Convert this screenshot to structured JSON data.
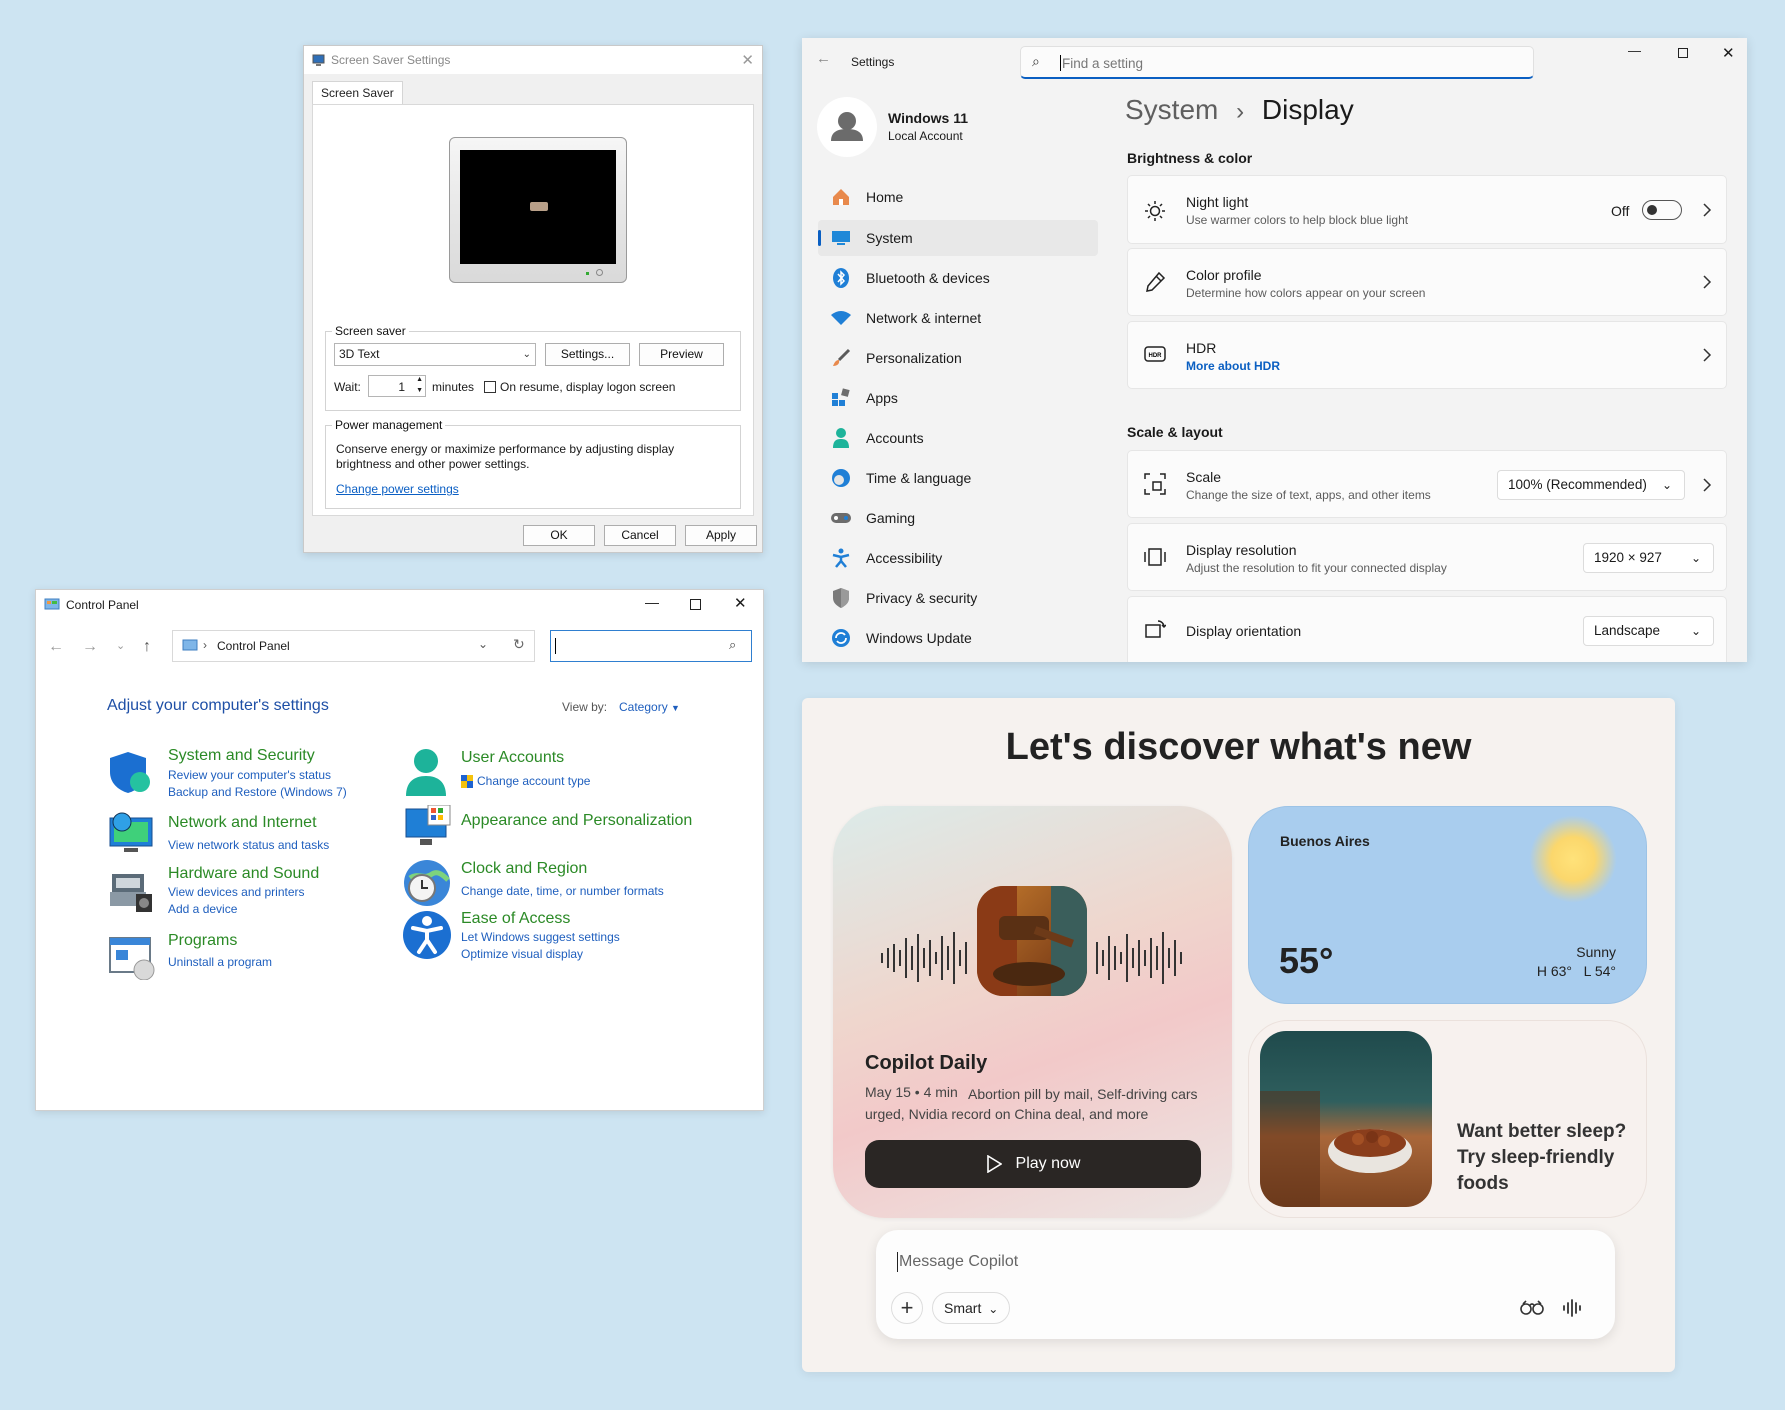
{
  "screen_saver": {
    "title": "Screen Saver Settings",
    "tab": "Screen Saver",
    "group_label": "Screen saver",
    "selected": "3D Text",
    "settings_button": "Settings...",
    "preview_button": "Preview",
    "wait_label": "Wait:",
    "wait_value": "1",
    "minutes_label": "minutes",
    "resume_checkbox": "On resume, display logon screen",
    "power_group": "Power management",
    "power_text": "Conserve energy or maximize performance by adjusting display brightness and other power settings.",
    "power_link": "Change power settings",
    "ok": "OK",
    "cancel": "Cancel",
    "apply": "Apply"
  },
  "control_panel": {
    "title": "Control Panel",
    "breadcrumb": "Control Panel",
    "heading": "Adjust your computer's settings",
    "view_by_label": "View by:",
    "view_by_value": "Category",
    "categories": [
      {
        "title": "System and Security",
        "links": [
          "Review your computer's status",
          "Backup and Restore (Windows 7)"
        ]
      },
      {
        "title": "Network and Internet",
        "links": [
          "View network status and tasks"
        ]
      },
      {
        "title": "Hardware and Sound",
        "links": [
          "View devices and printers",
          "Add a device"
        ]
      },
      {
        "title": "Programs",
        "links": [
          "Uninstall a program"
        ]
      },
      {
        "title": "User Accounts",
        "links": [
          "Change account type"
        ]
      },
      {
        "title": "Appearance and Personalization",
        "links": []
      },
      {
        "title": "Clock and Region",
        "links": [
          "Change date, time, or number formats"
        ]
      },
      {
        "title": "Ease of Access",
        "links": [
          "Let Windows suggest settings",
          "Optimize visual display"
        ]
      }
    ]
  },
  "settings": {
    "app_title": "Settings",
    "search_placeholder": "Find a setting",
    "account_name": "Windows 11",
    "account_type": "Local Account",
    "nav": [
      "Home",
      "System",
      "Bluetooth & devices",
      "Network & internet",
      "Personalization",
      "Apps",
      "Accounts",
      "Time & language",
      "Gaming",
      "Accessibility",
      "Privacy & security",
      "Windows Update"
    ],
    "breadcrumb_parent": "System",
    "breadcrumb_sep": "›",
    "page_title": "Display",
    "section_brightness": "Brightness & color",
    "night_light": {
      "title": "Night light",
      "subtitle": "Use warmer colors to help block blue light",
      "state": "Off"
    },
    "color_profile": {
      "title": "Color profile",
      "subtitle": "Determine how colors appear on your screen"
    },
    "hdr": {
      "title": "HDR",
      "link": "More about HDR"
    },
    "section_scale": "Scale & layout",
    "scale": {
      "title": "Scale",
      "subtitle": "Change the size of text, apps, and other items",
      "value": "100% (Recommended)"
    },
    "resolution": {
      "title": "Display resolution",
      "subtitle": "Adjust the resolution to fit your connected display",
      "value": "1920 × 927"
    },
    "orientation": {
      "title": "Display orientation",
      "value": "Landscape"
    }
  },
  "copilot": {
    "heading": "Let's discover what's new",
    "daily": {
      "title": "Copilot Daily",
      "meta": "May 15 • 4 min",
      "desc": "Abortion pill by mail, Self-driving cars urged, Nvidia record on China deal, and more",
      "play": "Play now"
    },
    "weather": {
      "city": "Buenos Aires",
      "temp": "55°",
      "condition": "Sunny",
      "hilo": "H 63°   L 54°"
    },
    "food": {
      "text": "Want better sleep? Try sleep-friendly foods"
    },
    "input_placeholder": "Message Copilot",
    "mode": "Smart"
  }
}
